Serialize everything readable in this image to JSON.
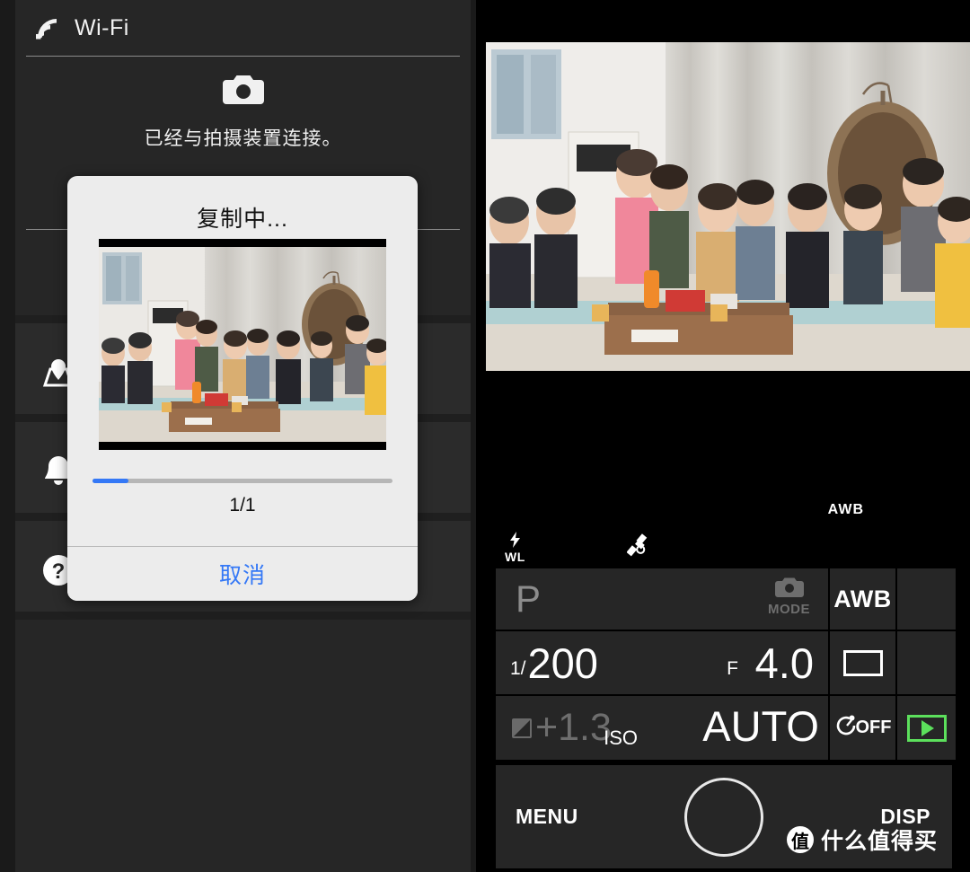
{
  "app": {
    "wifi_icon": "wifi-icon",
    "wifi_title": "Wi-Fi",
    "camera_icon": "camera-icon",
    "connected_text": "已经与拍摄装置连接。",
    "rows": [
      {
        "icon": "map-pin-icon",
        "name": "location-row"
      },
      {
        "icon": "bell-icon",
        "name": "notification-row"
      },
      {
        "icon": "question-mark-icon",
        "name": "help-row"
      }
    ]
  },
  "dialog": {
    "title": "复制中...",
    "thumbnail_alt": "group-photo-thumbnail",
    "progress_percent": 12,
    "progress_fill_color": "#3478f6",
    "count": "1/1",
    "cancel_label": "取消",
    "background_color": "#ececec"
  },
  "camera": {
    "live_view_alt": "live-view-group-photo",
    "status_icons": {
      "awb_float": "AWB",
      "flash_bolt": "⚡",
      "flash_mode": "WL",
      "gps_icon": "satellite-icon"
    },
    "grid": {
      "shoot_mode": "P",
      "mode_label": "MODE",
      "mode_icon": "camera-icon",
      "white_balance": "AWB",
      "shutter_prefix": "1/",
      "shutter_speed": "200",
      "aperture_prefix": "F",
      "aperture": "4.0",
      "aspect_icon": "aspect-ratio-icon",
      "ev_icon": "exposure-compensation-icon",
      "ev_value": "+1.3",
      "iso_prefix": "ISO",
      "iso_value": "AUTO",
      "timer_icon": "self-timer-icon",
      "timer_value": "OFF",
      "playback_icon": "playback-icon",
      "playback_color": "#5ce05c"
    },
    "bottom": {
      "menu_label": "MENU",
      "shutter_button": "shutter-release-button",
      "disp_label": "DISP"
    }
  },
  "watermark": {
    "badge": "值",
    "text": "什么值得买"
  }
}
